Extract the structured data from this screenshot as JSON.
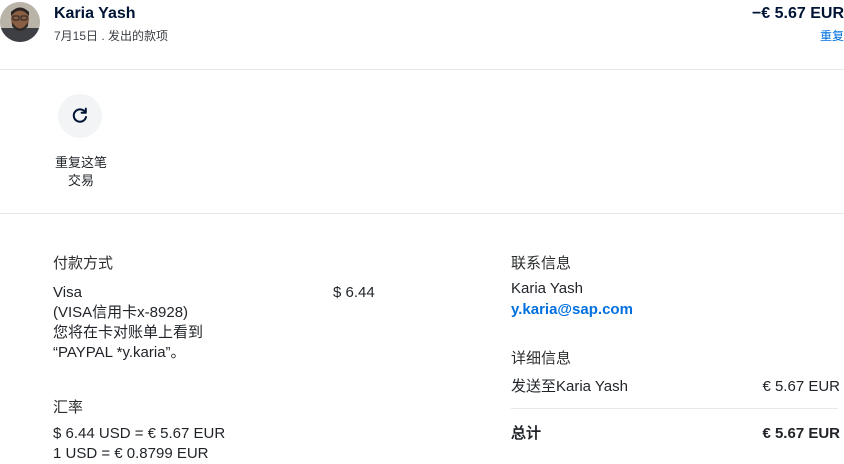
{
  "header": {
    "name": "Karia Yash",
    "subtitle": "7月15日 . 发出的款项",
    "amount": "−€ 5.67 EUR",
    "status": "重复"
  },
  "action": {
    "label": "重复这笔交易"
  },
  "payment": {
    "heading": "付款方式",
    "method": "Visa",
    "card": "(VISA信用卡x-8928)",
    "statement_note": "您将在卡对账单上看到",
    "statement_descriptor": "“PAYPAL *y.karia”。",
    "amount": "$ 6.44"
  },
  "exchange": {
    "heading": "汇率",
    "rate_line1": "$ 6.44 USD = € 5.67 EUR",
    "rate_line2": "1 USD = € 0.8799 EUR"
  },
  "contact": {
    "heading": "联系信息",
    "name": "Karia Yash",
    "email": "y.karia@sap.com"
  },
  "details": {
    "heading": "详细信息",
    "sent_to_label": "发送至Karia Yash",
    "sent_to_amount": "€ 5.67 EUR",
    "total_label": "总计",
    "total_amount": "€ 5.67 EUR"
  },
  "icons": {
    "repeat": "refresh-icon"
  },
  "colors": {
    "link": "#0070e0",
    "navy": "#001435"
  }
}
